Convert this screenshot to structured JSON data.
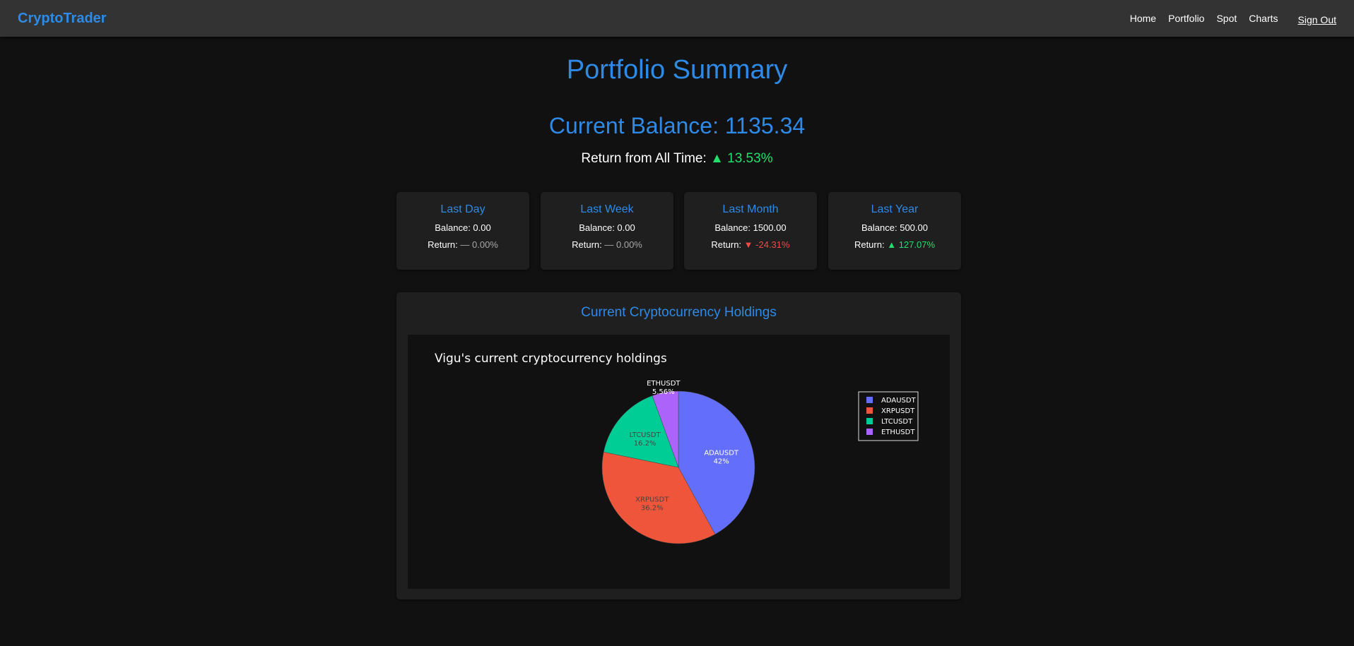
{
  "nav": {
    "brand": "CryptoTrader",
    "links": [
      "Home",
      "Portfolio",
      "Spot",
      "Charts"
    ],
    "sign_out": "Sign Out"
  },
  "header": {
    "title": "Portfolio Summary",
    "balance": "Current Balance: 1135.34",
    "return_label": "Return from All Time:",
    "return_value": "▲ 13.53%"
  },
  "cards": [
    {
      "title": "Last Day",
      "balance": "Balance: 0.00",
      "return_label": "Return:",
      "return_value": "— 0.00%",
      "trend": "flat"
    },
    {
      "title": "Last Week",
      "balance": "Balance: 0.00",
      "return_label": "Return:",
      "return_value": "— 0.00%",
      "trend": "flat"
    },
    {
      "title": "Last Month",
      "balance": "Balance: 1500.00",
      "return_label": "Return:",
      "return_value": "▼ -24.31%",
      "trend": "down"
    },
    {
      "title": "Last Year",
      "balance": "Balance: 500.00",
      "return_label": "Return:",
      "return_value": "▲ 127.07%",
      "trend": "up"
    }
  ],
  "holdings": {
    "section_title": "Current Cryptocurrency Holdings"
  },
  "colors": {
    "accent": "#2e8ae6",
    "positive": "#1ee06b",
    "negative": "#f04a4a",
    "neutral": "#a8a8a8"
  },
  "chart_data": {
    "type": "pie",
    "title": "Vigu's current cryptocurrency holdings",
    "labels": [
      "ADAUSDT",
      "XRPUSDT",
      "LTCUSDT",
      "ETHUSDT"
    ],
    "values": [
      42,
      36.2,
      16.2,
      5.56
    ],
    "value_labels": [
      "42%",
      "36.2%",
      "16.2%",
      "5.56%"
    ],
    "colors": [
      "#636efa",
      "#ef553b",
      "#00cc96",
      "#ab63fa"
    ],
    "legend": "top-right"
  }
}
